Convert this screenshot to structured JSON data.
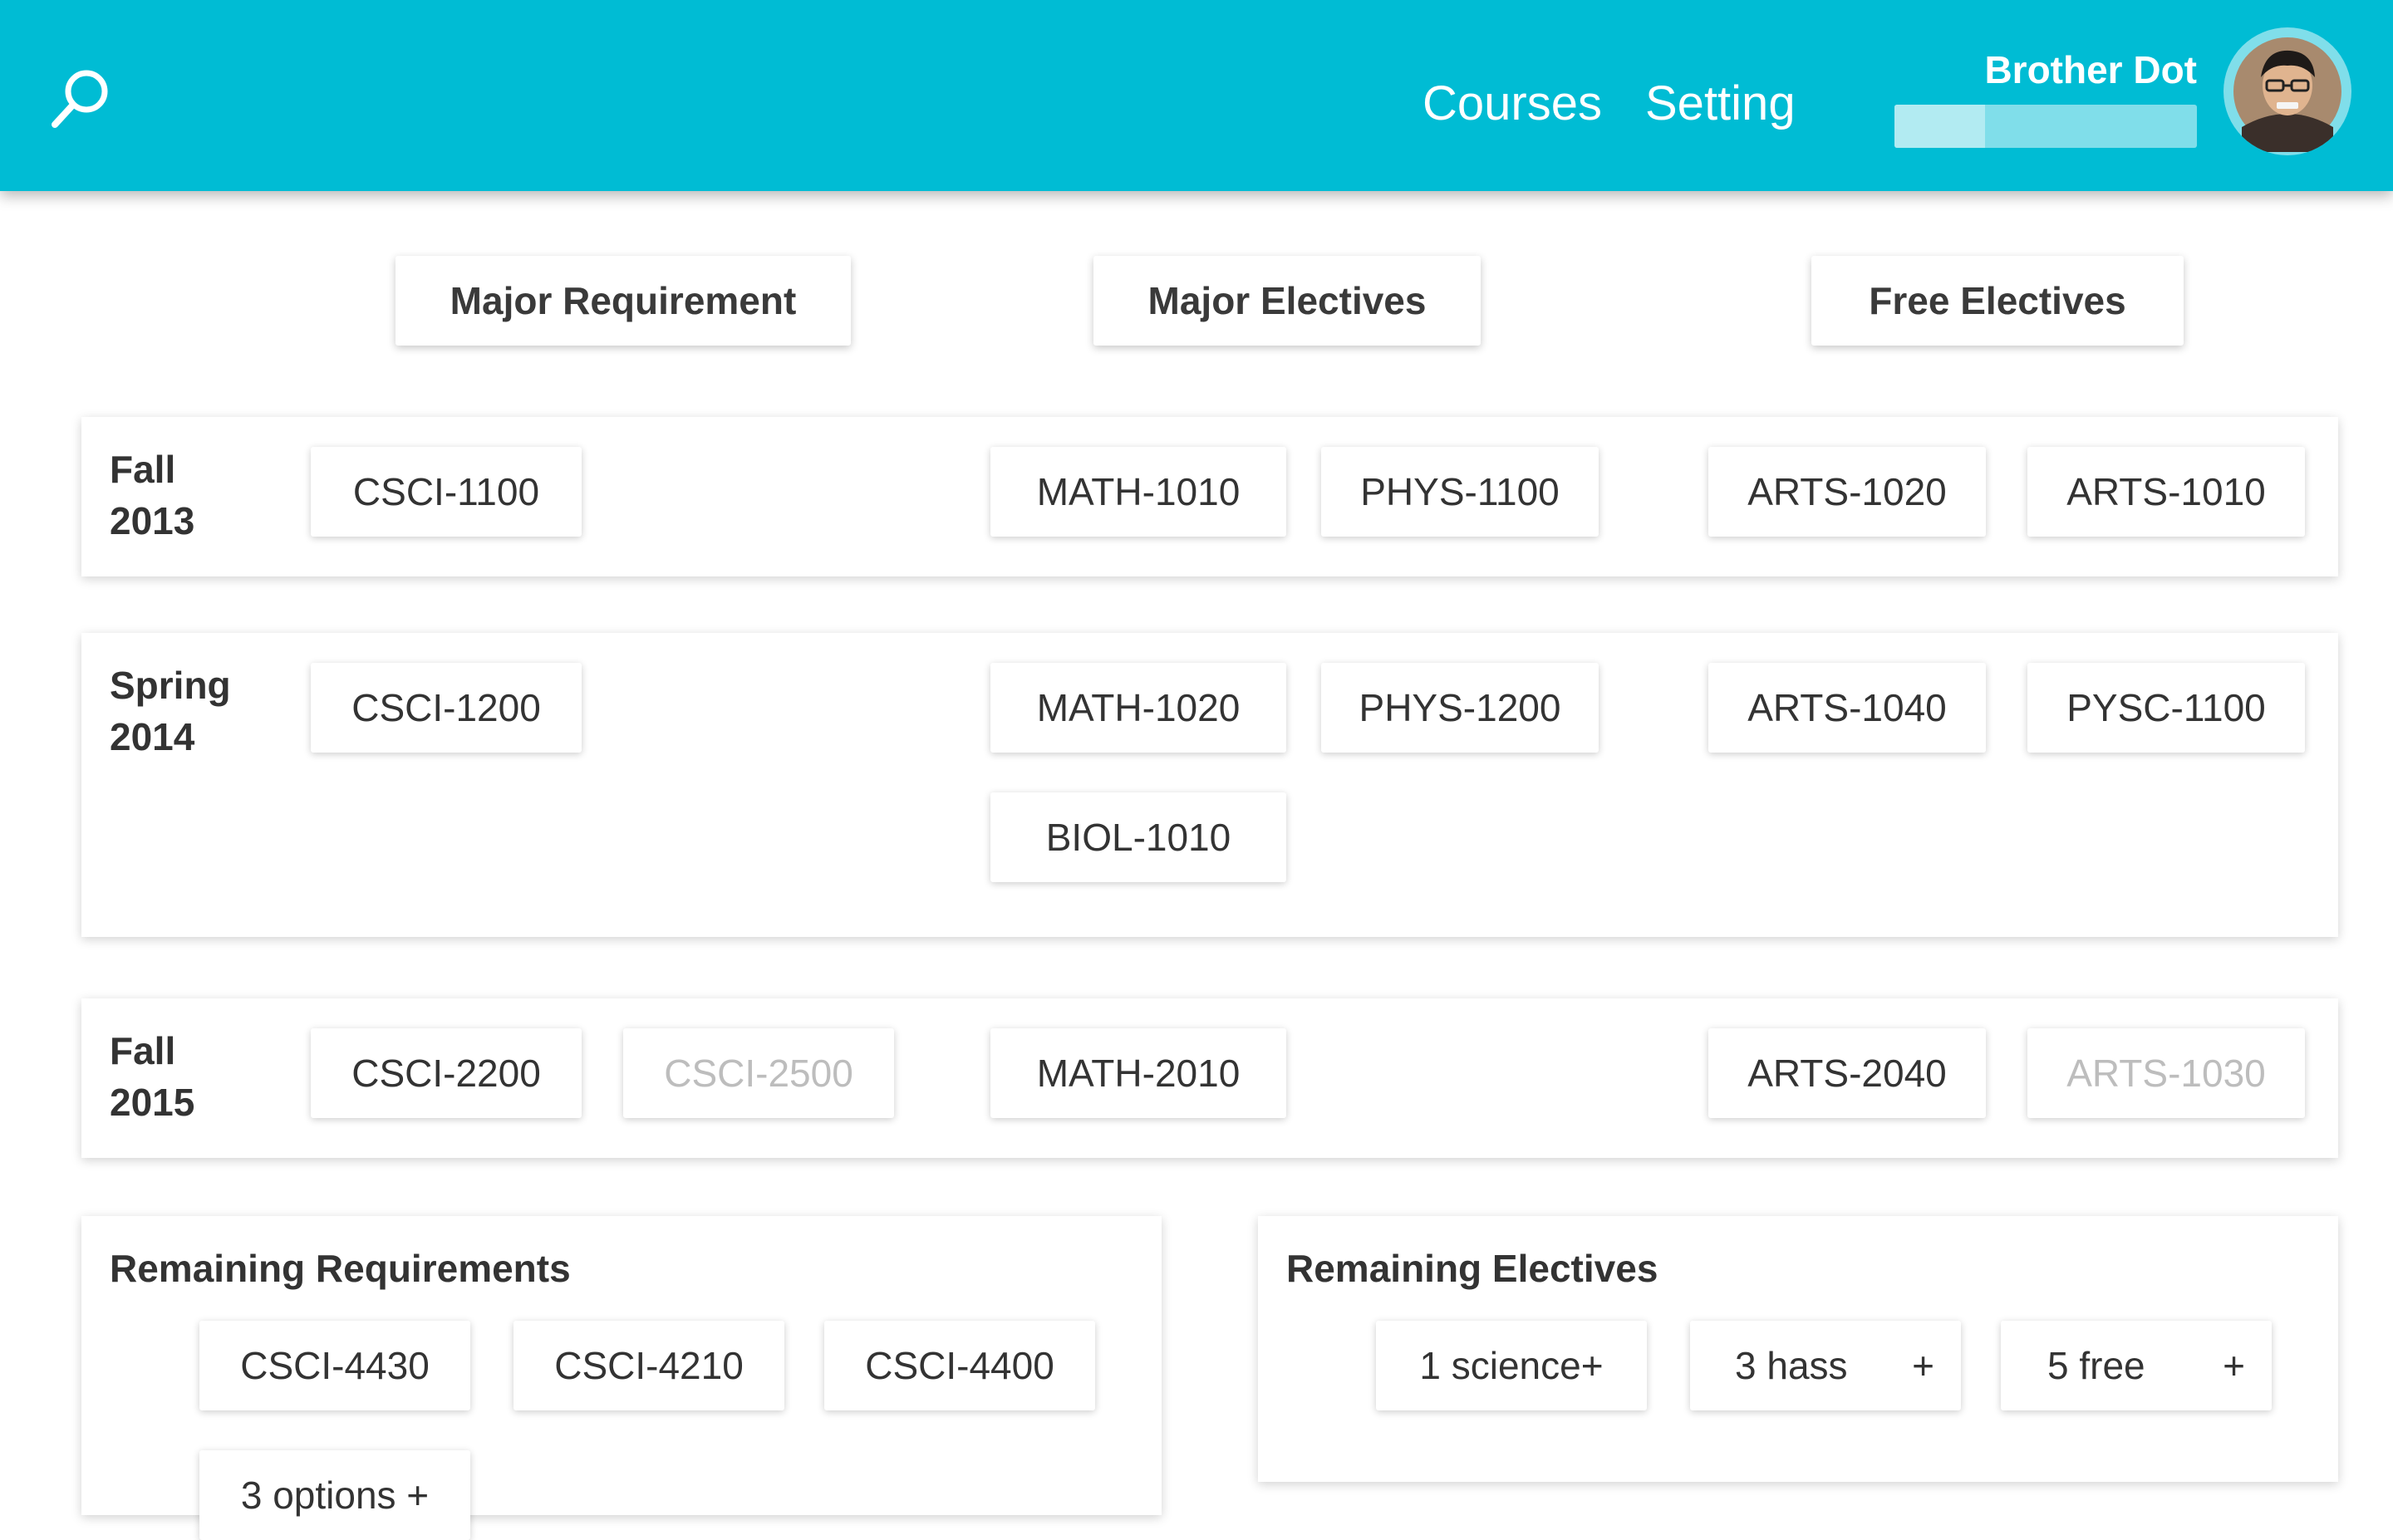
{
  "header": {
    "nav": [
      "Courses",
      "Setting"
    ],
    "user": {
      "name": "Brother Dot",
      "progress_fraction": 0.3
    },
    "colors": {
      "bar": "#00bcd4",
      "text": "#ffffff"
    },
    "icons": {
      "search": "search-icon",
      "avatar": "user-avatar"
    }
  },
  "filters": [
    "Major Requirement",
    "Major Electives",
    "Free Electives"
  ],
  "semesters": [
    {
      "label_line1": "Fall",
      "label_line2": "2013",
      "courses": [
        "CSCI-1100",
        "MATH-1010",
        "PHYS-1100",
        "ARTS-1020",
        "ARTS-1010"
      ]
    },
    {
      "label_line1": "Spring",
      "label_line2": "2014",
      "courses": [
        "CSCI-1200",
        "MATH-1020",
        "PHYS-1200",
        "ARTS-1040",
        "PYSC-1100",
        "BIOL-1010"
      ]
    },
    {
      "label_line1": "Fall",
      "label_line2": "2015",
      "courses": [
        "CSCI-2200",
        "CSCI-2500",
        "MATH-2010",
        "ARTS-2040",
        "ARTS-1030"
      ],
      "faded": [
        "CSCI-2500",
        "ARTS-1030"
      ]
    }
  ],
  "remaining_requirements": {
    "title": "Remaining Requirements",
    "items": [
      "CSCI-4430",
      "CSCI-4210",
      "CSCI-4400",
      "3 options +"
    ]
  },
  "remaining_electives": {
    "title": "Remaining Electives",
    "items": [
      "1 science+",
      "3 hass",
      "5 free"
    ],
    "plus": "+"
  }
}
